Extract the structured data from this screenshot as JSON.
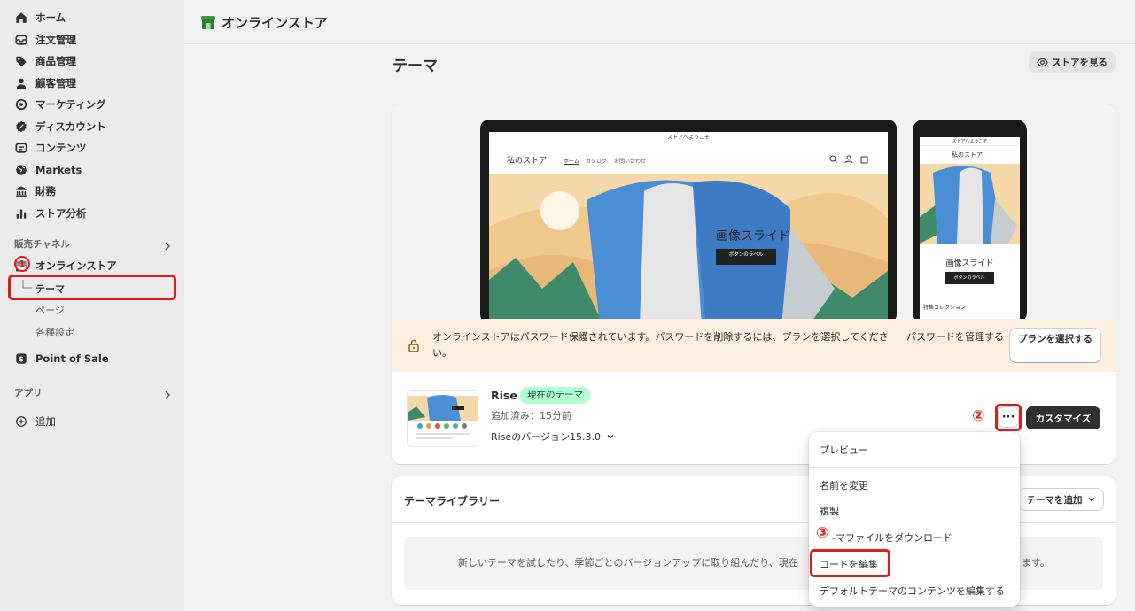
{
  "colors": {
    "accent_red": "#d81f1f",
    "badge_green": "#b4fed2",
    "banner_bg": "#fdefe0",
    "dark_button": "#303030"
  },
  "sidebar": {
    "items": [
      {
        "label": "ホーム",
        "icon": "home-icon"
      },
      {
        "label": "注文管理",
        "icon": "inbox-icon"
      },
      {
        "label": "商品管理",
        "icon": "tag-icon"
      },
      {
        "label": "顧客管理",
        "icon": "person-icon"
      },
      {
        "label": "マーケティング",
        "icon": "target-icon"
      },
      {
        "label": "ディスカウント",
        "icon": "discount-icon"
      },
      {
        "label": "コンテンツ",
        "icon": "content-icon"
      },
      {
        "label": "Markets",
        "icon": "globe-icon"
      },
      {
        "label": "財務",
        "icon": "bank-icon"
      },
      {
        "label": "ストア分析",
        "icon": "bar-chart-icon"
      }
    ],
    "sales_channels_label": "販売チャネル",
    "online_store_label": "オンラインストア",
    "sub_items": {
      "theme": "テーマ",
      "pages": "ページ",
      "settings": "各種設定"
    },
    "pos_label": "Point of Sale",
    "apps_label": "アプリ",
    "add_label": "追加"
  },
  "annotations": {
    "one": "1",
    "two": "②",
    "three": "③"
  },
  "header": {
    "title": "オンラインストア"
  },
  "page": {
    "title": "テーマ",
    "view_store": "ストアを見る"
  },
  "preview": {
    "laptop": {
      "announcement": "ストアへようこそ",
      "store_name": "私のストア",
      "nav": [
        "ホーム",
        "カタログ",
        "お問い合わせ"
      ],
      "slide_title": "画像スライド",
      "button_label": "ボタンのラベル"
    },
    "phone": {
      "announcement": "ストアへようこそ",
      "store_name": "私のストア",
      "slide_title": "画像スライド",
      "button_label": "ボタンのラベル",
      "collection": "特集コレクション"
    }
  },
  "banner": {
    "message": "オンラインストアはパスワード保護されています。パスワードを削除するには、プランを選択してください。",
    "manage_password": "パスワードを管理する",
    "select_plan": "プランを選択する"
  },
  "theme": {
    "name": "Rise",
    "badge": "現在のテーマ",
    "added": "追加済み：15分前",
    "version": "Riseのバージョン15.3.0",
    "more": "···",
    "customize": "カスタマイズ"
  },
  "library": {
    "title": "テーマライブラリー",
    "add_theme": "テーマを追加",
    "empty_text_a": "新しいテーマを試したり、季節ごとのバージョンアップに取り組んだり、現在",
    "empty_text_b": "ます。"
  },
  "menu": {
    "items": [
      "プレビュー",
      "名前を変更",
      "複製",
      "-マファイルをダウンロード",
      "コードを編集",
      "デフォルトテーマのコンテンツを編集する"
    ]
  }
}
